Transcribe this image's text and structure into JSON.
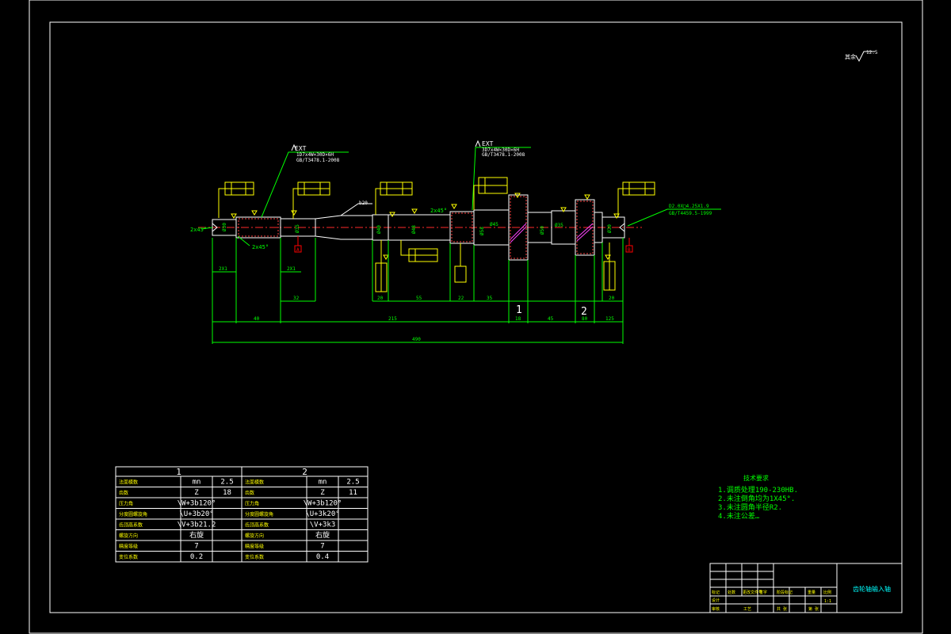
{
  "colors": {
    "background": "#000000",
    "border": "#ffffff",
    "geometry": "#ffffff",
    "dimension": "#00ff00",
    "annotation": "#ffff00",
    "centerline": "#ff2a2a",
    "datum": "#ff0000",
    "text_green": "#00ff00",
    "title_text": "#00ffff"
  },
  "surface_symbol": {
    "label": "其余",
    "value": "12.5"
  },
  "thread_notes": {
    "left": {
      "symbol": "EXT",
      "line1": "1D7x4W×30D×6H",
      "line2": "GB/T3478.1-2008"
    },
    "middle": {
      "symbol": "EXT",
      "line1": "3D7x4W×30D×6H",
      "line2": "GB/T3478.1-2008"
    },
    "right": {
      "line1": "D2.0X□4.25X1.9",
      "line2": "GB/T4459.5-1999"
    }
  },
  "chamfer_labels": [
    "2x45°",
    "2x45°",
    "2x45°"
  ],
  "section_labels": {
    "gear1": "1",
    "gear2": "2"
  },
  "datum_labels": {
    "a": "A",
    "b": "B"
  },
  "dimensions": {
    "small": [
      "2X1",
      "2X1",
      "32",
      "20",
      "55",
      "22",
      "35",
      "20"
    ],
    "overall_row": [
      "40",
      "215",
      "18",
      "45",
      "80",
      "125"
    ],
    "total": "490",
    "diameters": [
      "Ø30",
      "Ø35",
      "Ø40",
      "Ø48",
      "Ø58",
      "Ø45",
      "Ø50",
      "Ø35",
      "Ø30"
    ],
    "lead": "b20"
  },
  "gear_table": {
    "headers": [
      "1",
      "2"
    ],
    "rows": [
      {
        "label1": "法面模数",
        "sym1": "mn",
        "val1": "2.5",
        "label2": "法面模数",
        "sym2": "mn",
        "val2": "2.5"
      },
      {
        "label1": "齿数",
        "sym1": "Z",
        "val1": "18",
        "label2": "齿数",
        "sym2": "Z",
        "val2": "11"
      },
      {
        "label1": "压力角",
        "sym1": "\\W+3b120°",
        "val1": "",
        "label2": "压力角",
        "sym2": "\\W+3b120°",
        "val2": ""
      },
      {
        "label1": "分度圆螺旋角",
        "sym1": "\\U+3b20°",
        "val1": "",
        "label2": "分度圆螺旋角",
        "sym2": "\\U+3k20°",
        "val2": ""
      },
      {
        "label1": "齿顶高系数",
        "sym1": "\\V+3b21.2",
        "val1": "",
        "label2": "齿顶高系数",
        "sym2": "\\V+3k3",
        "val2": ""
      },
      {
        "label1": "螺旋方向",
        "sym1": "右旋",
        "val1": "",
        "label2": "螺旋方向",
        "sym2": "右旋",
        "val2": ""
      },
      {
        "label1": "精度等级",
        "sym1": "7",
        "val1": "",
        "label2": "精度等级",
        "sym2": "7",
        "val2": ""
      },
      {
        "label1": "变位系数",
        "sym1": "0.2",
        "val1": "",
        "label2": "变位系数",
        "sym2": "0.4",
        "val2": ""
      }
    ]
  },
  "tech_notes": {
    "title": "技术要求",
    "items": [
      "1.调质处理190-230HB.",
      "2.未注倒角均为1X45°.",
      "3.未注圆角半径R2.",
      "4.未注公差…"
    ]
  },
  "title_block": {
    "title": "齿轮轴输入轴",
    "cells": [
      "标记",
      "处数",
      "更改文件号",
      "签字",
      "日期",
      "设计",
      "审核",
      "工艺",
      "批准",
      "阶段标记",
      "重量",
      "比例",
      "共 张",
      "第 张",
      "1:1"
    ]
  }
}
